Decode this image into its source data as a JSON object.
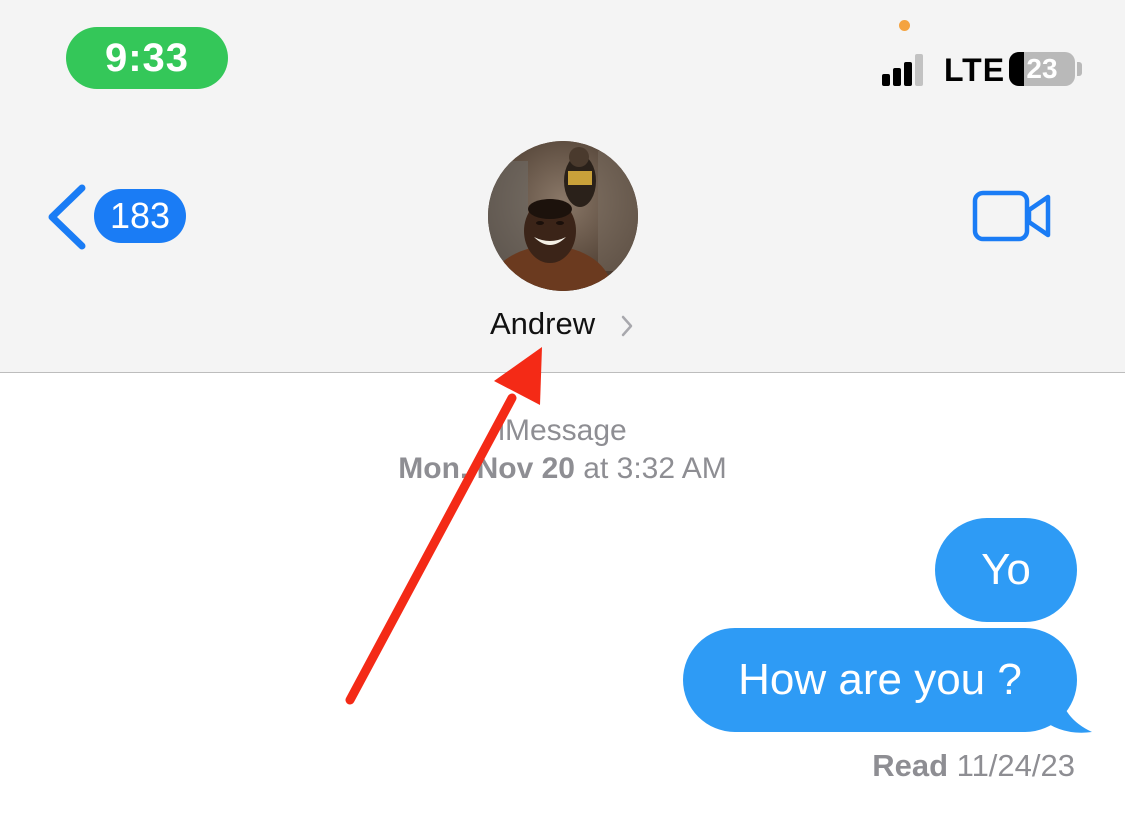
{
  "status_bar": {
    "time": "9:33",
    "network": "LTE",
    "battery_percent": "23",
    "battery_level": 0.23,
    "signal_bars_active": 3,
    "colors": {
      "clock_pill": "#34c759",
      "privacy_dot": "#f4a340"
    }
  },
  "nav": {
    "back_icon": "chevron-left-icon",
    "back_count": "183",
    "contact_name": "Andrew",
    "contact_chevron_icon": "chevron-right-icon",
    "avatar_icon": "contact-photo",
    "facetime_icon": "video-camera-icon"
  },
  "conversation": {
    "service_label": "iMessage",
    "timestamp_day": "Mon, Nov 20",
    "timestamp_at": " at 3:32 AM",
    "messages": [
      {
        "text": "Yo",
        "sender": "me"
      },
      {
        "text": "How are you ?",
        "sender": "me"
      }
    ],
    "read_label": "Read",
    "read_date": " 11/24/23"
  },
  "annotation": {
    "type": "arrow",
    "color": "#f42a16",
    "points_to": "contact-name"
  },
  "colors": {
    "accent": "#1a7cf5",
    "bubble": "#2e9bf5",
    "header_bg": "#f4f4f4",
    "secondary_text": "#8e8e93"
  }
}
